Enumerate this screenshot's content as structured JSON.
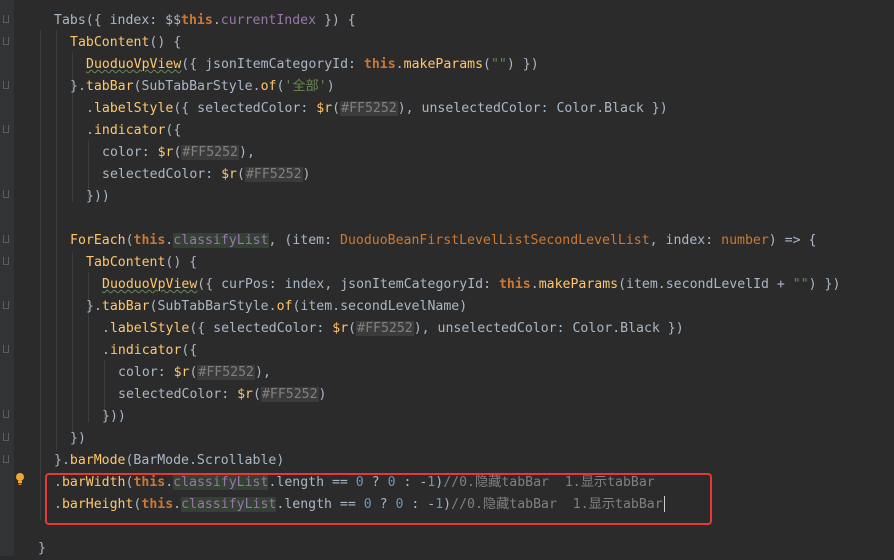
{
  "editor": {
    "lines": [
      {
        "id": "l1",
        "segs": [
          [
            "tx",
            "Tabs({ index: $$"
          ],
          [
            "this",
            "this"
          ],
          [
            "tx",
            "."
          ],
          [
            "m",
            "currentIndex"
          ],
          [
            "tx",
            " }) {"
          ]
        ]
      },
      {
        "id": "l2",
        "segs": [
          [
            "f",
            "TabContent"
          ],
          [
            "tx",
            "() {"
          ]
        ]
      },
      {
        "id": "l3",
        "segs": [
          [
            "f",
            "DuoduoVpView",
            "ul"
          ],
          [
            "tx",
            "({ jsonItemCategoryId: "
          ],
          [
            "this",
            "this"
          ],
          [
            "tx",
            "."
          ],
          [
            "f",
            "makeParams"
          ],
          [
            "tx",
            "("
          ],
          [
            "s",
            "\"\""
          ],
          [
            "tx",
            ") })"
          ]
        ]
      },
      {
        "id": "l4",
        "segs": [
          [
            "tx",
            "}."
          ],
          [
            "f",
            "tabBar"
          ],
          [
            "tx",
            "(SubTabBarStyle."
          ],
          [
            "f",
            "of"
          ],
          [
            "tx",
            "("
          ],
          [
            "s",
            "'全部'"
          ],
          [
            "tx",
            ")"
          ]
        ]
      },
      {
        "id": "l5",
        "segs": [
          [
            "tx",
            "."
          ],
          [
            "f",
            "labelStyle"
          ],
          [
            "tx",
            "({ selectedColor: "
          ],
          [
            "f",
            "$r"
          ],
          [
            "tx",
            "("
          ],
          [
            "hex",
            "#FF5252"
          ],
          [
            "tx",
            "), unselectedColor: Color.Black })"
          ]
        ]
      },
      {
        "id": "l6",
        "segs": [
          [
            "tx",
            "."
          ],
          [
            "f",
            "indicator"
          ],
          [
            "tx",
            "({"
          ]
        ]
      },
      {
        "id": "l7",
        "segs": [
          [
            "tx",
            "color: "
          ],
          [
            "f",
            "$r"
          ],
          [
            "tx",
            "("
          ],
          [
            "hex",
            "#FF5252"
          ],
          [
            "tx",
            "),"
          ]
        ]
      },
      {
        "id": "l8",
        "segs": [
          [
            "tx",
            "selectedColor: "
          ],
          [
            "f",
            "$r"
          ],
          [
            "tx",
            "("
          ],
          [
            "hex",
            "#FF5252"
          ],
          [
            "tx",
            ")"
          ]
        ]
      },
      {
        "id": "l9",
        "segs": [
          [
            "tx",
            "}))"
          ]
        ]
      },
      {
        "id": "l10",
        "segs": []
      },
      {
        "id": "l11",
        "segs": [
          [
            "f",
            "ForEach"
          ],
          [
            "tx",
            "("
          ],
          [
            "this",
            "this"
          ],
          [
            "tx",
            "."
          ],
          [
            "mh",
            "classifyList"
          ],
          [
            "tx",
            ", (item: "
          ],
          [
            "t",
            "DuoduoBeanFirstLevelListSecondLevelList"
          ],
          [
            "tx",
            ", index: "
          ],
          [
            "t",
            "number"
          ],
          [
            "tx",
            ") => {"
          ]
        ]
      },
      {
        "id": "l12",
        "segs": [
          [
            "f",
            "TabContent"
          ],
          [
            "tx",
            "() {"
          ]
        ]
      },
      {
        "id": "l13",
        "segs": [
          [
            "f",
            "DuoduoVpView",
            "ul"
          ],
          [
            "tx",
            "({ curPos: index, jsonItemCategoryId: "
          ],
          [
            "this",
            "this"
          ],
          [
            "tx",
            "."
          ],
          [
            "f",
            "makeParams"
          ],
          [
            "tx",
            "(item.secondLevelId + "
          ],
          [
            "s",
            "\"\""
          ],
          [
            "tx",
            ") })"
          ]
        ]
      },
      {
        "id": "l14",
        "segs": [
          [
            "tx",
            "}."
          ],
          [
            "f",
            "tabBar"
          ],
          [
            "tx",
            "(SubTabBarStyle."
          ],
          [
            "f",
            "of"
          ],
          [
            "tx",
            "(item.secondLevelName)"
          ]
        ]
      },
      {
        "id": "l15",
        "segs": [
          [
            "tx",
            "."
          ],
          [
            "f",
            "labelStyle"
          ],
          [
            "tx",
            "({ selectedColor: "
          ],
          [
            "f",
            "$r"
          ],
          [
            "tx",
            "("
          ],
          [
            "hex",
            "#FF5252"
          ],
          [
            "tx",
            "), unselectedColor: Color.Black })"
          ]
        ]
      },
      {
        "id": "l16",
        "segs": [
          [
            "tx",
            "."
          ],
          [
            "f",
            "indicator"
          ],
          [
            "tx",
            "({"
          ]
        ]
      },
      {
        "id": "l17",
        "segs": [
          [
            "tx",
            "color: "
          ],
          [
            "f",
            "$r"
          ],
          [
            "tx",
            "("
          ],
          [
            "hex",
            "#FF5252"
          ],
          [
            "tx",
            "),"
          ]
        ]
      },
      {
        "id": "l18",
        "segs": [
          [
            "tx",
            "selectedColor: "
          ],
          [
            "f",
            "$r"
          ],
          [
            "tx",
            "("
          ],
          [
            "hex",
            "#FF5252"
          ],
          [
            "tx",
            ")"
          ]
        ]
      },
      {
        "id": "l19",
        "segs": [
          [
            "tx",
            "}))"
          ]
        ]
      },
      {
        "id": "l20",
        "segs": [
          [
            "tx",
            "})"
          ]
        ]
      },
      {
        "id": "l21",
        "segs": [
          [
            "tx",
            "}."
          ],
          [
            "f",
            "barMode"
          ],
          [
            "tx",
            "(BarMode.Scrollable)"
          ]
        ]
      },
      {
        "id": "l22",
        "segs": [
          [
            "tx",
            "."
          ],
          [
            "f",
            "barWidth"
          ],
          [
            "tx",
            "("
          ],
          [
            "this",
            "this"
          ],
          [
            "tx",
            "."
          ],
          [
            "mh",
            "classifyList"
          ],
          [
            "tx",
            ".length == "
          ],
          [
            "n",
            "0"
          ],
          [
            "tx",
            " ? "
          ],
          [
            "n",
            "0"
          ],
          [
            "tx",
            " : -"
          ],
          [
            "n",
            "1"
          ],
          [
            "tx",
            ")"
          ],
          [
            "c",
            "//0.隐藏tabBar  1.显示tabBar"
          ]
        ]
      },
      {
        "id": "l23",
        "segs": [
          [
            "tx",
            "."
          ],
          [
            "f",
            "barHeight"
          ],
          [
            "tx",
            "("
          ],
          [
            "this",
            "this"
          ],
          [
            "tx",
            "."
          ],
          [
            "mh",
            "classifyList"
          ],
          [
            "tx",
            ".length == "
          ],
          [
            "n",
            "0"
          ],
          [
            "tx",
            " ? "
          ],
          [
            "n",
            "0"
          ],
          [
            "tx",
            " : -"
          ],
          [
            "n",
            "1"
          ],
          [
            "tx",
            ")"
          ],
          [
            "c",
            "//0.隐藏tabBar  1.显示tabBar"
          ],
          [
            "caret",
            ""
          ]
        ]
      },
      {
        "id": "l24",
        "segs": []
      },
      {
        "id": "l25",
        "segs": [
          [
            "tx",
            "}"
          ]
        ]
      }
    ]
  },
  "icons": {
    "gutter_hint": "lightbulb-icon"
  }
}
